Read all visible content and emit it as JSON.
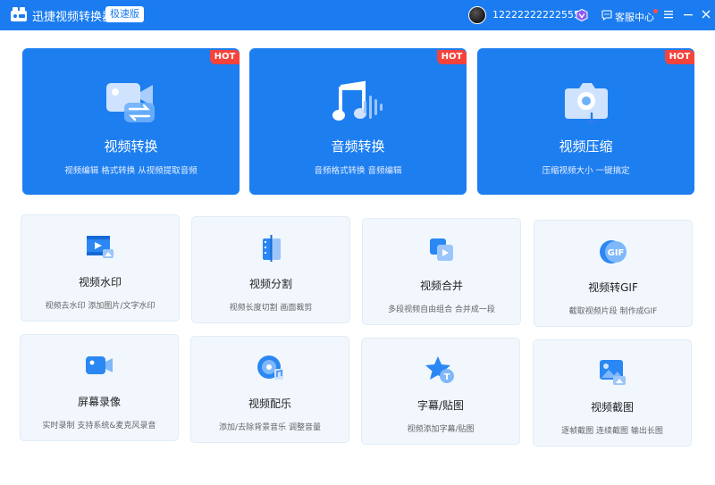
{
  "app": {
    "title": "迅捷视频转换器",
    "edition": "极速版"
  },
  "user": {
    "name": "12222222222555"
  },
  "header": {
    "service_label": "客服中心"
  },
  "colors": {
    "primary": "#1a7cf0",
    "hot": "#f5433c",
    "card_bg": "#f1f7fd"
  },
  "big_cards": [
    {
      "title": "视频转换",
      "desc": "视频编辑 格式转换 从视频提取音频",
      "badge": "HOT",
      "icon": "video-convert-icon"
    },
    {
      "title": "音频转换",
      "desc": "音频格式转换 音频编辑",
      "badge": "HOT",
      "icon": "audio-convert-icon"
    },
    {
      "title": "视频压缩",
      "desc": "压缩视频大小 一键搞定",
      "badge": "HOT",
      "icon": "video-compress-icon"
    }
  ],
  "small_cards": [
    {
      "title": "视频水印",
      "desc": "视频去水印 添加图片/文字水印",
      "icon": "watermark-icon"
    },
    {
      "title": "视频分割",
      "desc": "视频长度切割 画面裁剪",
      "icon": "split-icon"
    },
    {
      "title": "视频合并",
      "desc": "多段视频自由组合 合并成一段",
      "icon": "merge-icon"
    },
    {
      "title": "视频转GIF",
      "desc": "截取视频片段 制作成GIF",
      "icon": "gif-icon",
      "icon_text": "GIF"
    },
    {
      "title": "屏幕录像",
      "desc": "实时录制 支持系统&麦克风录音",
      "icon": "screen-record-icon"
    },
    {
      "title": "视频配乐",
      "desc": "添加/去除背景音乐 调整音量",
      "icon": "music-icon"
    },
    {
      "title": "字幕/贴图",
      "desc": "视频添加字幕/贴图",
      "icon": "subtitle-icon",
      "icon_text": "T"
    },
    {
      "title": "视频截图",
      "desc": "逐帧截图 连续截图 输出长图",
      "icon": "screenshot-icon"
    }
  ]
}
